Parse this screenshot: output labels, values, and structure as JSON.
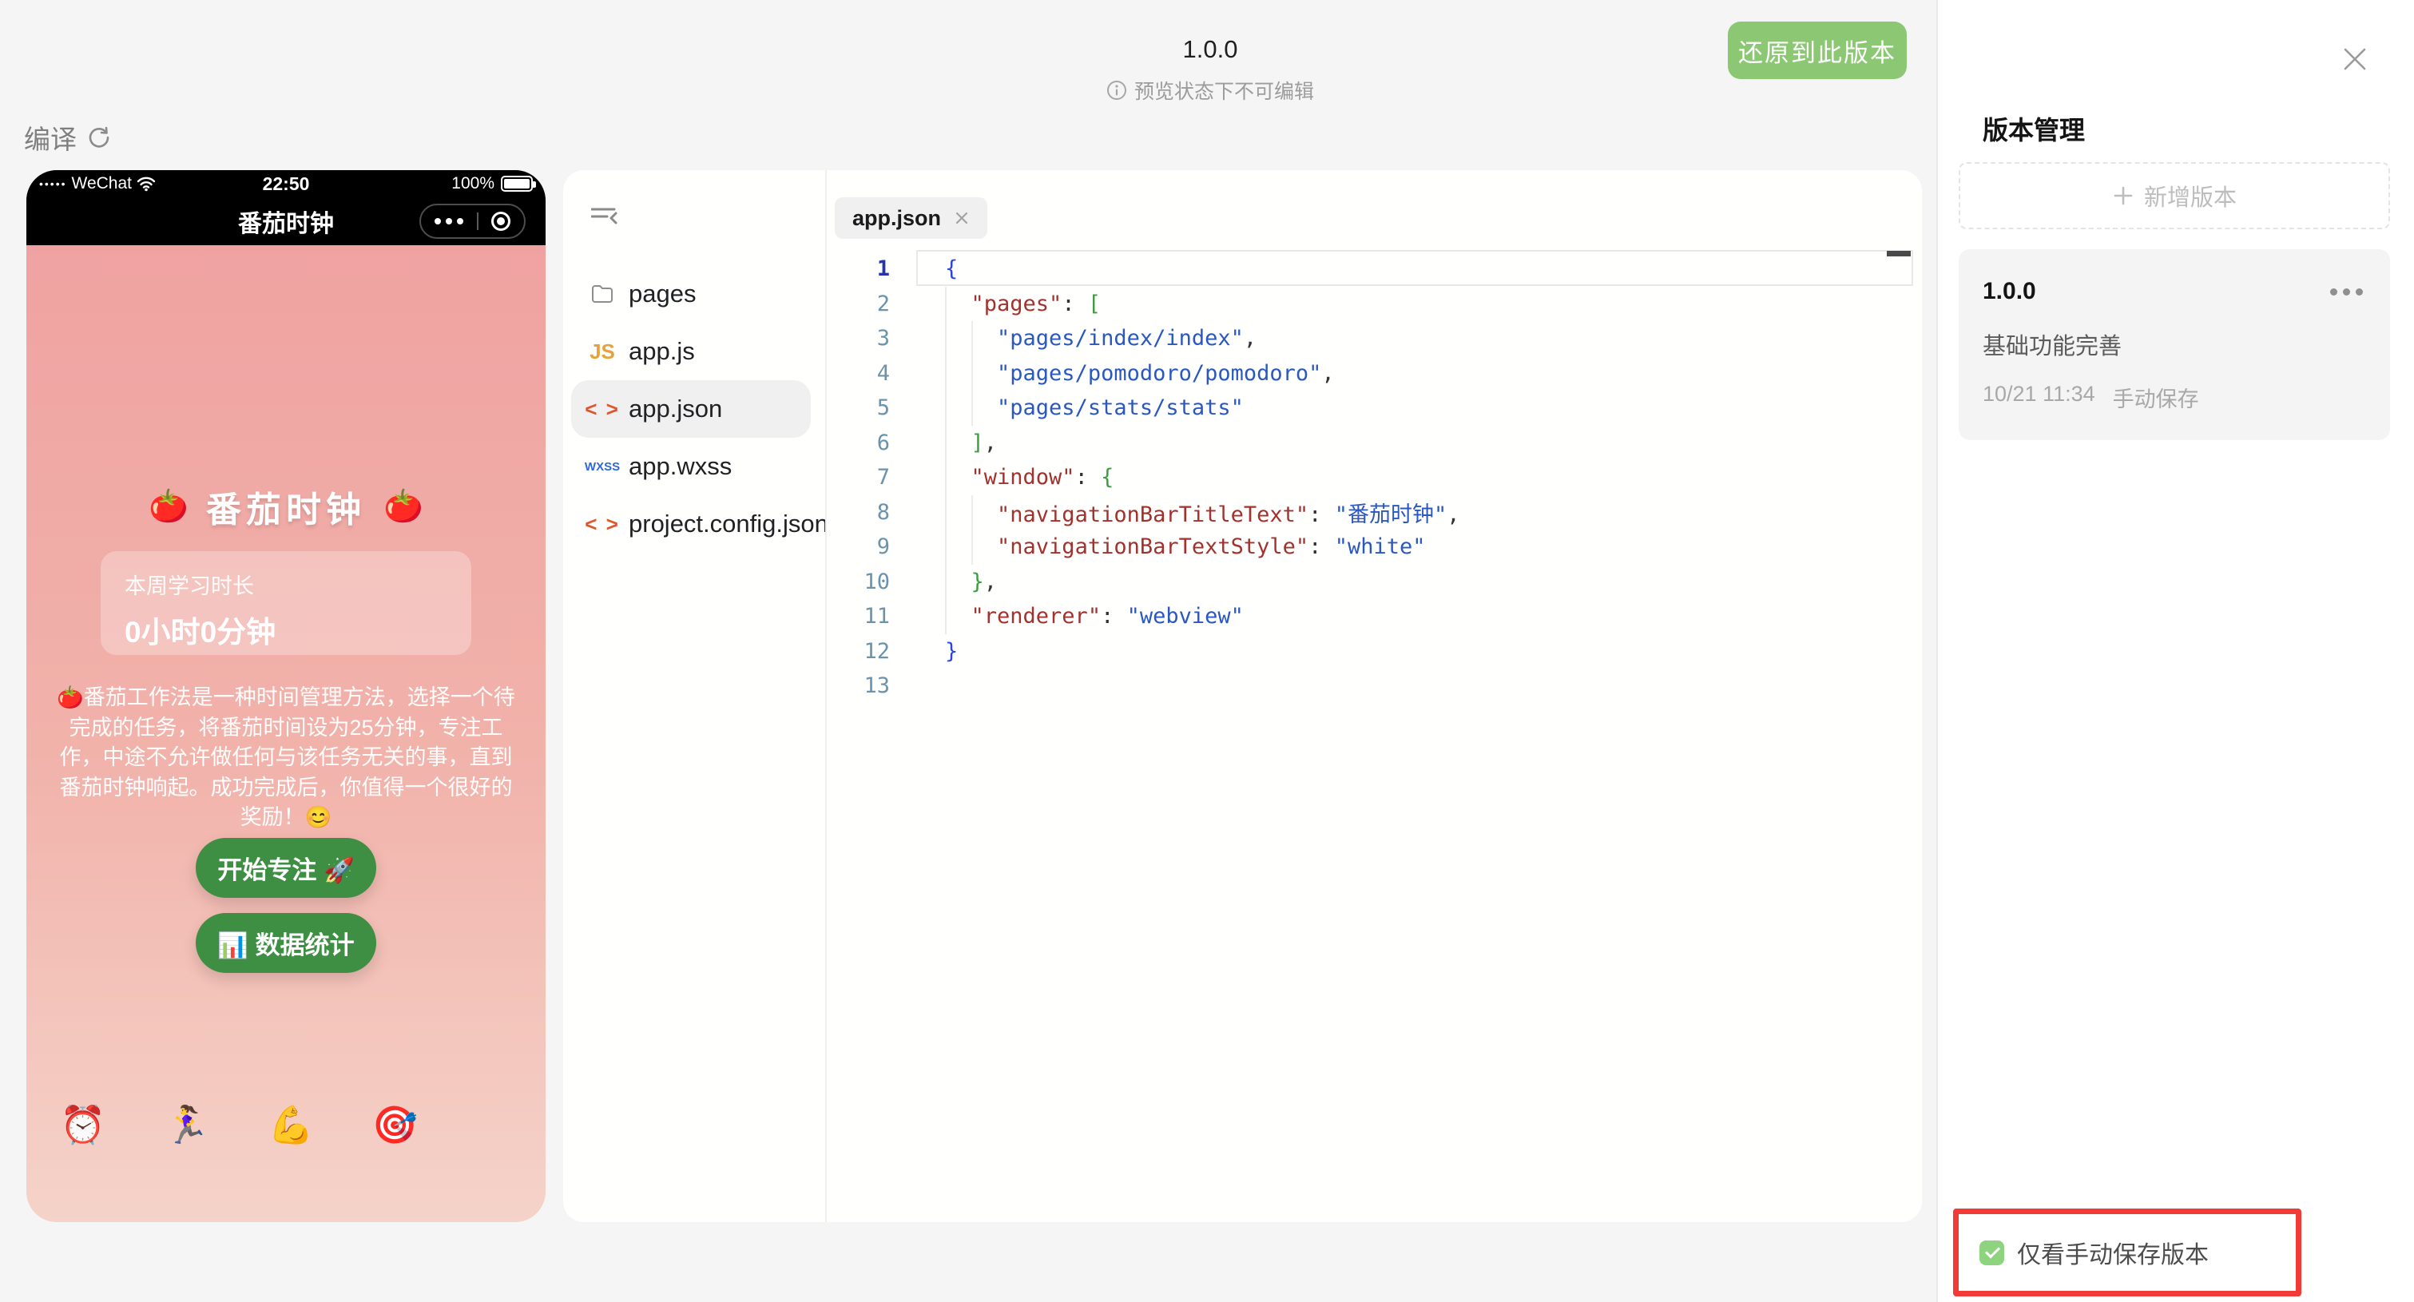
{
  "header": {
    "version": "1.0.0",
    "notice": "预览状态下不可编辑",
    "restore_label": "还原到此版本",
    "compile_label": "编译"
  },
  "icons": {
    "notice": "info-circle",
    "compile": "refresh-circular-arrow",
    "panel_close": "x-close",
    "tab_close": "x-close",
    "tree_collapse": "collapse-sidebar",
    "folder": "folder-outline",
    "version_more": "ellipsis-dots",
    "add_version": "plus",
    "wifi": "wifi-signal",
    "battery": "battery-full",
    "capsule_record": "record-dot",
    "checkbox": "green-check"
  },
  "phone": {
    "status_bar": {
      "signal_dots": "•••••",
      "carrier": "WeChat",
      "time": "22:50",
      "battery_percent": "100%"
    },
    "nav_bar": {
      "title": "番茄时钟"
    },
    "home": {
      "tomato_emoji": "🍅",
      "app_title": "番茄时钟",
      "stats_label": "本周学习时长",
      "stats_value": "0小时0分钟",
      "description": "🍅番茄工作法是一种时间管理方法，选择一个待完成的任务，将番茄时间设为25分钟，专注工作，中途不允许做任何与该任务无关的事，直到番茄时钟响起。成功完成后，你值得一个很好的奖励！😊",
      "start_button": "开始专注 🚀",
      "stats_button": "📊 数据统计",
      "footer_emojis": [
        "⏰",
        "🏃‍♀️",
        "💪",
        "🎯"
      ]
    }
  },
  "ide": {
    "file_tree": [
      {
        "icon": "folder",
        "badge": "",
        "label": "pages",
        "selected": false
      },
      {
        "icon": "js",
        "badge": "JS",
        "label": "app.js",
        "selected": false
      },
      {
        "icon": "code",
        "badge": "<>",
        "label": "app.json",
        "selected": true
      },
      {
        "icon": "wxss",
        "badge": "WXSS",
        "label": "app.wxss",
        "selected": false
      },
      {
        "icon": "code",
        "badge": "<>",
        "label": "project.config.json",
        "selected": false
      }
    ],
    "editor": {
      "tab": "app.json",
      "active_line": 1,
      "lines": [
        {
          "n": 1,
          "guides": [],
          "tokens": [
            {
              "t": "{",
              "c": "b1"
            }
          ]
        },
        {
          "n": 2,
          "guides": [
            0
          ],
          "tokens": [
            {
              "t": "  ",
              "c": "pun"
            },
            {
              "t": "\"pages\"",
              "c": "key"
            },
            {
              "t": ": ",
              "c": "pun"
            },
            {
              "t": "[",
              "c": "b2"
            }
          ]
        },
        {
          "n": 3,
          "guides": [
            0,
            1
          ],
          "tokens": [
            {
              "t": "    ",
              "c": "pun"
            },
            {
              "t": "\"pages/index/index\"",
              "c": "str"
            },
            {
              "t": ",",
              "c": "pun"
            }
          ]
        },
        {
          "n": 4,
          "guides": [
            0,
            1
          ],
          "tokens": [
            {
              "t": "    ",
              "c": "pun"
            },
            {
              "t": "\"pages/pomodoro/pomodoro\"",
              "c": "str"
            },
            {
              "t": ",",
              "c": "pun"
            }
          ]
        },
        {
          "n": 5,
          "guides": [
            0,
            1
          ],
          "tokens": [
            {
              "t": "    ",
              "c": "pun"
            },
            {
              "t": "\"pages/stats/stats\"",
              "c": "str"
            }
          ]
        },
        {
          "n": 6,
          "guides": [
            0
          ],
          "tokens": [
            {
              "t": "  ",
              "c": "pun"
            },
            {
              "t": "]",
              "c": "b2"
            },
            {
              "t": ",",
              "c": "pun"
            }
          ]
        },
        {
          "n": 7,
          "guides": [
            0
          ],
          "tokens": [
            {
              "t": "  ",
              "c": "pun"
            },
            {
              "t": "\"window\"",
              "c": "key"
            },
            {
              "t": ": ",
              "c": "pun"
            },
            {
              "t": "{",
              "c": "b2"
            }
          ]
        },
        {
          "n": 8,
          "guides": [
            0,
            1
          ],
          "tokens": [
            {
              "t": "    ",
              "c": "pun"
            },
            {
              "t": "\"navigationBarTitleText\"",
              "c": "key"
            },
            {
              "t": ": ",
              "c": "pun"
            },
            {
              "t": "\"番茄时钟\"",
              "c": "str"
            },
            {
              "t": ",",
              "c": "pun"
            }
          ]
        },
        {
          "n": 9,
          "guides": [
            0,
            1
          ],
          "tokens": [
            {
              "t": "    ",
              "c": "pun"
            },
            {
              "t": "\"navigationBarTextStyle\"",
              "c": "key"
            },
            {
              "t": ": ",
              "c": "pun"
            },
            {
              "t": "\"white\"",
              "c": "str"
            }
          ]
        },
        {
          "n": 10,
          "guides": [
            0
          ],
          "tokens": [
            {
              "t": "  ",
              "c": "pun"
            },
            {
              "t": "}",
              "c": "b2"
            },
            {
              "t": ",",
              "c": "pun"
            }
          ]
        },
        {
          "n": 11,
          "guides": [
            0
          ],
          "tokens": [
            {
              "t": "  ",
              "c": "pun"
            },
            {
              "t": "\"renderer\"",
              "c": "key"
            },
            {
              "t": ": ",
              "c": "pun"
            },
            {
              "t": "\"webview\"",
              "c": "str"
            }
          ]
        },
        {
          "n": 12,
          "guides": [],
          "tokens": [
            {
              "t": "}",
              "c": "b1"
            }
          ]
        },
        {
          "n": 13,
          "guides": [],
          "tokens": []
        }
      ]
    }
  },
  "version_panel": {
    "title": "版本管理",
    "add_button": "新增版本",
    "versions": [
      {
        "version": "1.0.0",
        "description": "基础功能完善",
        "date": "10/21 11:34",
        "save_type": "手动保存"
      }
    ],
    "filter": {
      "label": "仅看手动保存版本",
      "checked": true
    }
  },
  "colors": {
    "restore_button_green": "#8cc873",
    "phone_button_green": "#3e8e44",
    "checkbox_green": "#8ed47e",
    "highlight_red": "#f23a36",
    "phone_gradient_top": "#efa0a0",
    "phone_gradient_bottom": "#f5d3c9"
  }
}
